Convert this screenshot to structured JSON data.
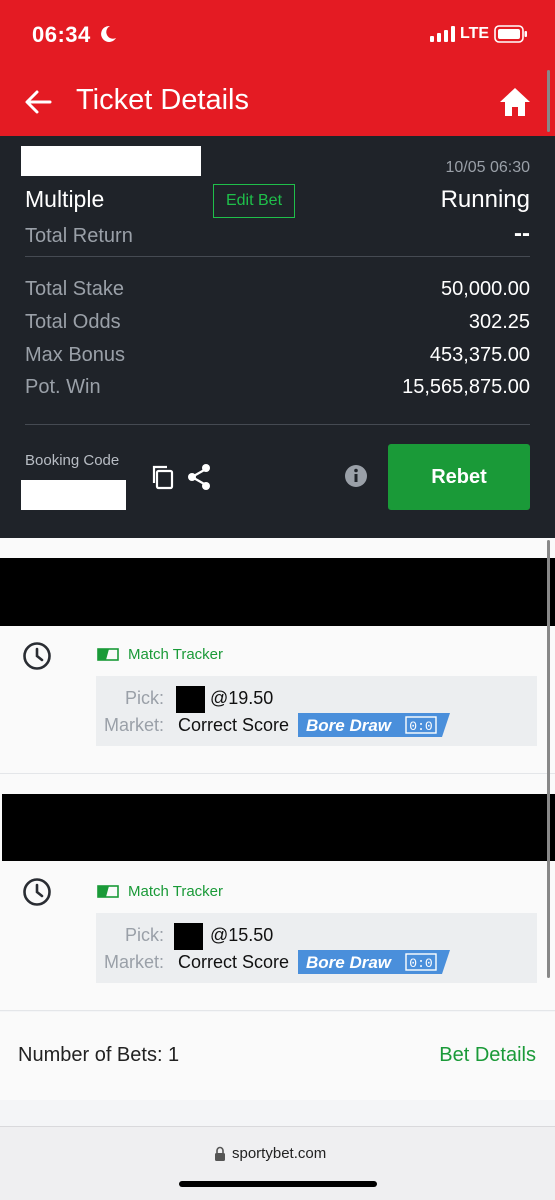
{
  "status_bar": {
    "time": "06:34",
    "network": "LTE"
  },
  "header": {
    "title": "Ticket Details"
  },
  "ticket": {
    "date": "10/05 06:30",
    "type": "Multiple",
    "edit_label": "Edit Bet",
    "status": "Running",
    "total_return_label": "Total Return",
    "total_return_value": "--",
    "rows": [
      {
        "label": "Total Stake",
        "value": "50,000.00"
      },
      {
        "label": "Total Odds",
        "value": "302.25"
      },
      {
        "label": "Max Bonus",
        "value": "453,375.00"
      },
      {
        "label": "Pot. Win",
        "value": "15,565,875.00"
      }
    ],
    "booking_code_label": "Booking Code",
    "rebet_label": "Rebet"
  },
  "bets": [
    {
      "tracker_label": "Match Tracker",
      "pick_label": "Pick:",
      "odds": "@19.50",
      "market_label": "Market:",
      "market_value": "Correct Score",
      "tag": {
        "text": "Bore Draw",
        "score": "0:0"
      }
    },
    {
      "tracker_label": "Match Tracker",
      "pick_label": "Pick:",
      "odds": "@15.50",
      "market_label": "Market:",
      "market_value": "Correct Score",
      "tag": {
        "text": "Bore Draw",
        "score": "0:0"
      }
    }
  ],
  "summary": {
    "number_of_bets": "Number of Bets: 1",
    "bet_details_label": "Bet Details"
  },
  "browser": {
    "url": "sportybet.com"
  },
  "colors": {
    "brand_red": "#e41b23",
    "accent_green": "#1a9a38",
    "tag_blue": "#4a8fdb",
    "panel_dark": "#1f2329"
  }
}
